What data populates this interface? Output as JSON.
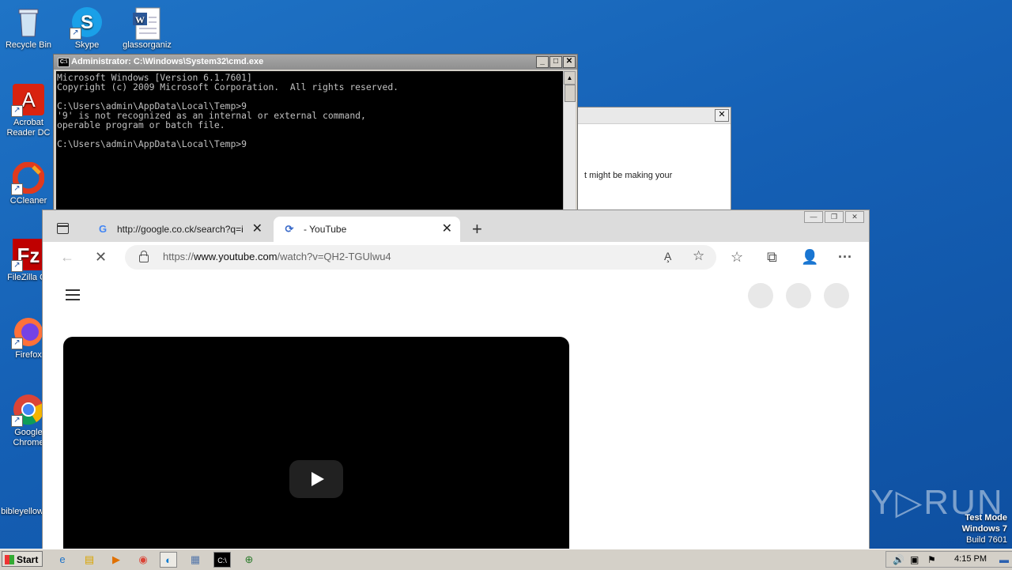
{
  "desktop": {
    "icons": [
      {
        "label": "Recycle Bin"
      },
      {
        "label": "Skype"
      },
      {
        "label": "glassorganiz"
      },
      {
        "label": "Acrobat Reader DC"
      },
      {
        "label": "CCleaner"
      },
      {
        "label": "FileZilla Cli"
      },
      {
        "label": "Firefox"
      },
      {
        "label": "Google Chrome"
      },
      {
        "label": "bibleyellow"
      }
    ]
  },
  "dialog": {
    "close": "✕",
    "text": "t might be making your"
  },
  "cmd": {
    "title": "Administrator: C:\\Windows\\System32\\cmd.exe",
    "icon_text": "C:\\",
    "btn_min": "_",
    "btn_max": "□",
    "btn_close": "✕",
    "lines": [
      "Microsoft Windows [Version 6.1.7601]",
      "Copyright (c) 2009 Microsoft Corporation.  All rights reserved.",
      "",
      "C:\\Users\\admin\\AppData\\Local\\Temp>9",
      "'9' is not recognized as an internal or external command,",
      "operable program or batch file.",
      "",
      "C:\\Users\\admin\\AppData\\Local\\Temp>9"
    ]
  },
  "browser": {
    "tabs": [
      {
        "title": "http://google.co.ck/search?q=i",
        "favicon": "G"
      },
      {
        "title": "- YouTube",
        "favicon": "⟳"
      }
    ],
    "tab_close": "✕",
    "new_tab": "+",
    "window_buttons": {
      "min": "—",
      "max": "❐",
      "close": "✕"
    },
    "toolbar": {
      "back": "←",
      "stop": "✕",
      "url_prefix": "https://",
      "url_domain": "www.youtube.com",
      "url_path": "/watch?v=QH2-TGUlwu4",
      "read_aloud": "A̧",
      "add_fav": "☆",
      "favorites": "☆",
      "collections": "⧉",
      "profile": "👤",
      "more": "···"
    }
  },
  "watermark": {
    "text": "ANY▷RUN"
  },
  "testmode": {
    "line1": "Test Mode",
    "line2": "Windows 7",
    "line3": "Build 7601"
  },
  "taskbar": {
    "start": "Start",
    "clock": "4:15 PM",
    "apps": [
      "ie-icon",
      "explorer-icon",
      "media-icon",
      "chrome-icon",
      "edge-icon",
      "notepad-icon",
      "cmd-icon",
      "network-icon"
    ]
  }
}
